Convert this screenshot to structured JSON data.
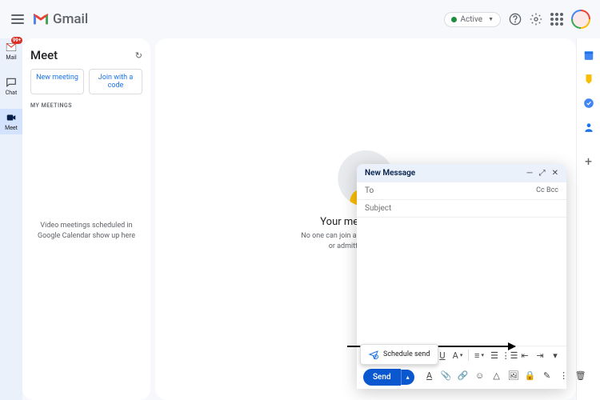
{
  "header": {
    "app_name": "Gmail",
    "active_label": "Active"
  },
  "rail": {
    "mail": "Mail",
    "chat": "Chat",
    "meet": "Meet",
    "badge": "99+"
  },
  "meet": {
    "title": "Meet",
    "new_meeting": "New meeting",
    "join_code": "Join with a code",
    "my_meetings": "MY MEETINGS",
    "empty_line1": "Video meetings scheduled in",
    "empty_line2": "Google Calendar show up here"
  },
  "hero": {
    "title": "Your meeting's safe",
    "sub1": "No one can join a meeting unless invited",
    "sub2": "or admitted by the host"
  },
  "compose": {
    "title": "New Message",
    "to_label": "To",
    "cc": "Cc",
    "bcc": "Bcc",
    "subject_placeholder": "Subject",
    "send": "Send",
    "schedule": "Schedule send"
  }
}
